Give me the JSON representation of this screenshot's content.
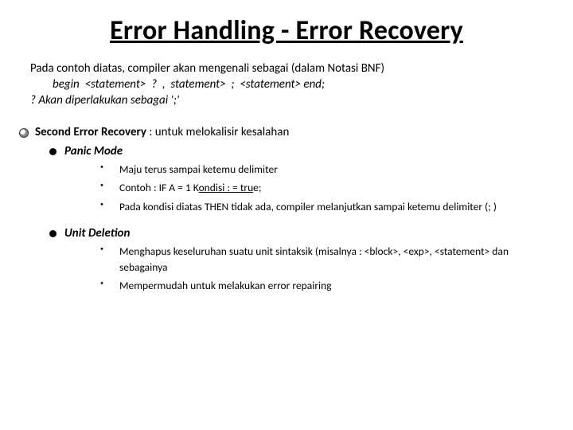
{
  "title": "Error Handling - Error Recovery",
  "intro": "Pada contoh diatas, compiler akan mengenali sebagai (dalam Notasi BNF)",
  "code_line1": "begin  <statement>  ?  ,  statement>  ;  <statement> end;",
  "code_line2": "? Akan diperlakukan sebagai ';'",
  "section": {
    "lead": "Second Error Recovery",
    "rest": " : untuk melokalisir kesalahan"
  },
  "panic": {
    "title": "Panic Mode",
    "items": [
      "Maju terus sampai ketemu delimiter",
      "",
      "Pada kondisi diatas THEN  tidak ada, compiler melanjutkan sampai ketemu delimiter (; )"
    ],
    "ex_pre": "Contoh : IF A = 1  K",
    "ex_cond": "ondisi : =  tru",
    "ex_post": "e;"
  },
  "unit": {
    "title": "Unit Deletion",
    "items": [
      "Menghapus keseluruhan suatu unit sintaksik (misalnya : <block>, <exp>, <statement> dan sebagainya",
      "Mempermudah untuk melakukan error repairing"
    ]
  }
}
